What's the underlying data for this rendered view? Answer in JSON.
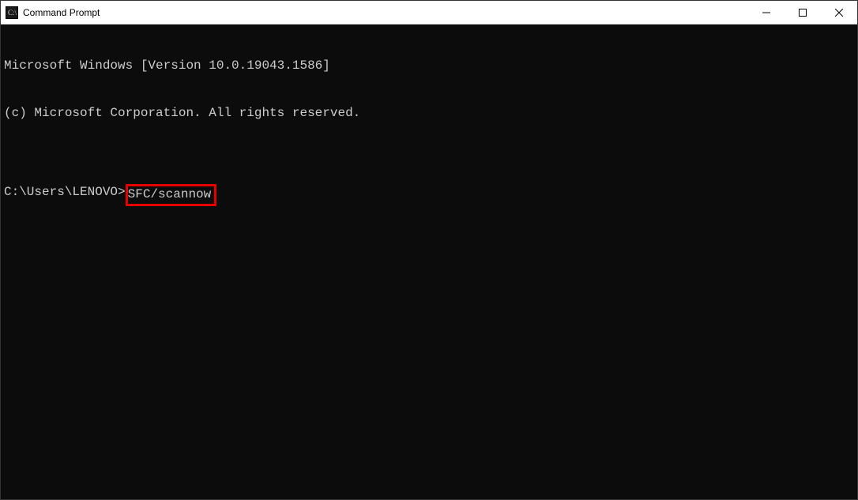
{
  "titlebar": {
    "title": "Command Prompt"
  },
  "terminal": {
    "line1": "Microsoft Windows [Version 10.0.19043.1586]",
    "line2": "(c) Microsoft Corporation. All rights reserved.",
    "blank": "",
    "prompt": "C:\\Users\\LENOVO>",
    "command": "SFC/scannow"
  }
}
